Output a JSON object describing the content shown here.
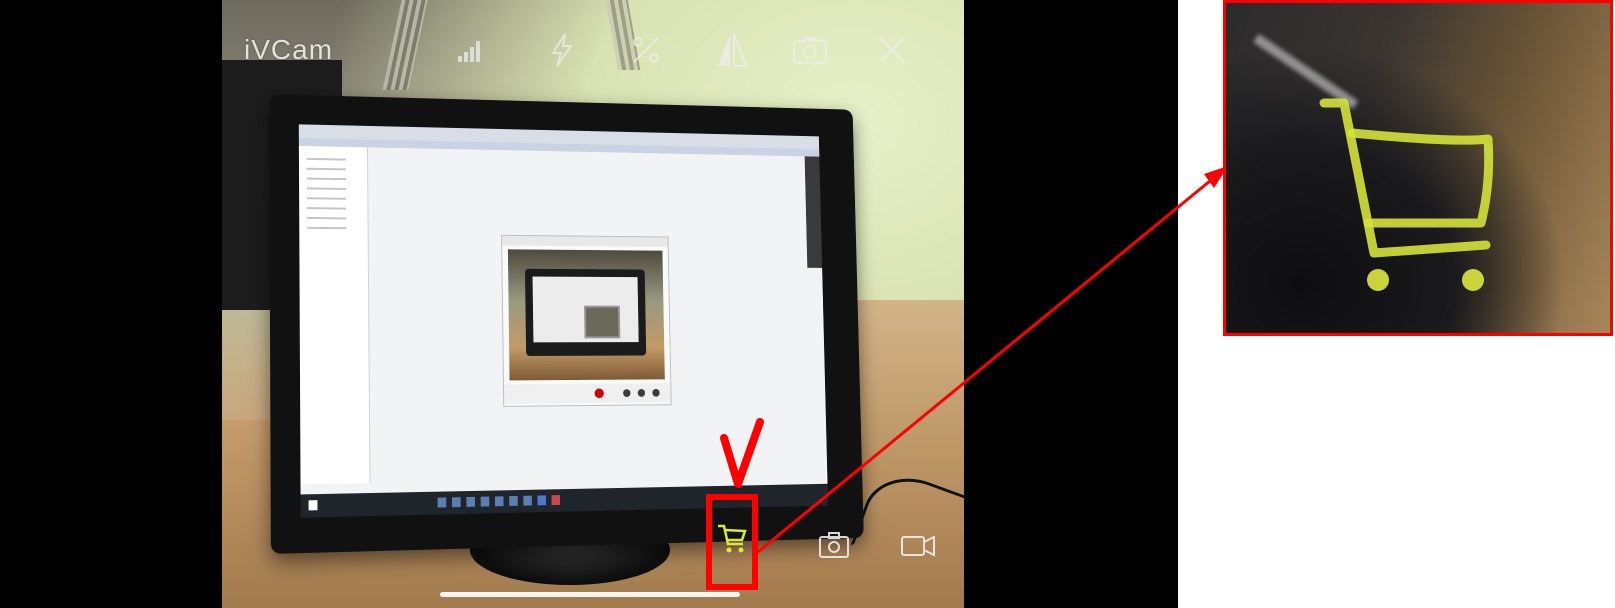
{
  "app": {
    "name": "iVCam"
  },
  "top_toolbar": {
    "icons": [
      "signal-strength-icon",
      "flash-icon",
      "hdr-icon",
      "mirror-icon",
      "switch-camera-icon",
      "close-icon"
    ]
  },
  "bottom_toolbar": {
    "icons": [
      "cart-icon",
      "camera-icon",
      "video-icon"
    ]
  },
  "annotation": {
    "highlight_color": "#ff0000",
    "cart_color": "#d9ea3a",
    "check_mark_color": "#ff0000"
  }
}
